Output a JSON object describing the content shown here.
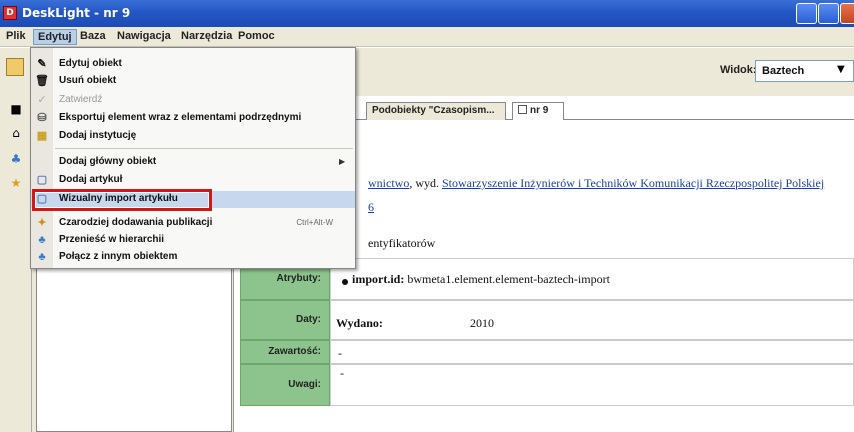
{
  "window": {
    "title": "DeskLight - nr 9",
    "app_icon_text": "D"
  },
  "menubar": {
    "items": [
      "Plik",
      "Edytuj",
      "Baza",
      "Nawigacja",
      "Narzędzia",
      "Pomoc"
    ]
  },
  "toolbar": {
    "widok_label": "Widok:",
    "widok_value": "Baztech"
  },
  "tabs": [
    {
      "label": "Podobiekty \"Czasopism...",
      "active": false
    },
    {
      "label": "nr 9",
      "active": true
    }
  ],
  "details": {
    "line1_prefix": "wnictwo",
    "line1_mid": ", wyd. ",
    "line1_link": "Stowarzyszenie Inżynierów i Techników Komunikacji Rzeczpospolitej Polskiej",
    "line2_link": "6",
    "line3": "entyfikatorów"
  },
  "grid": {
    "atrybuty": {
      "label": "Atrybuty:",
      "key": "import.id:",
      "value": "bwmeta1.element.element-baztech-import"
    },
    "daty": {
      "label": "Daty:",
      "key": "Wydano:",
      "value": "2010"
    },
    "zawartosc": {
      "label": "Zawartość:",
      "value": "-"
    },
    "uwagi": {
      "label": "Uwagi:",
      "value": "-"
    }
  },
  "dropdown": {
    "items": [
      {
        "label": "Edytuj obiekt",
        "icon": "edit-icon",
        "enabled": true
      },
      {
        "label": "Usuń obiekt",
        "icon": "trash-icon",
        "enabled": true
      },
      {
        "label": "Zatwierdź",
        "icon": "check-icon",
        "enabled": false
      },
      {
        "label": "Eksportuj element wraz z elementami podrzędnymi",
        "icon": "database-icon",
        "enabled": true
      },
      {
        "label": "Dodaj instytucję",
        "icon": "building-icon",
        "enabled": true
      },
      {
        "label": "Dodaj główny obiekt",
        "icon": "",
        "enabled": true,
        "submenu": true
      },
      {
        "label": "Dodaj artykuł",
        "icon": "document-icon",
        "enabled": true
      },
      {
        "label": "Wizualny import artykułu",
        "icon": "document-icon",
        "enabled": true,
        "highlighted": true
      },
      {
        "label": "Czarodziej dodawania publikacji",
        "icon": "wizard-icon",
        "enabled": true,
        "shortcut": "Ctrl+Alt-W"
      },
      {
        "label": "Przenieść w hierarchii",
        "icon": "hierarchy-icon",
        "enabled": true
      },
      {
        "label": "Połącz z innym obiektem",
        "icon": "hierarchy-icon",
        "enabled": true
      }
    ]
  }
}
